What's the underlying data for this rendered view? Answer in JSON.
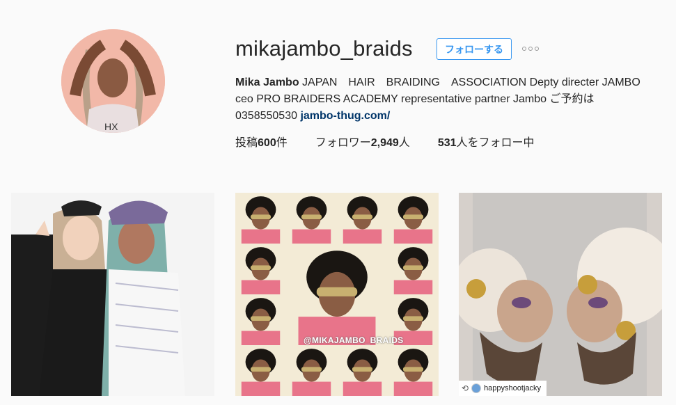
{
  "profile": {
    "username": "mikajambo_braids",
    "follow_label": "フォローする",
    "bio_name": "Mika Jambo",
    "bio_line1": " JAPAN　HAIR　BRAIDING　ASSOCIATION Depty directer JAMBO",
    "bio_line2": "ceo PRO BRAIDERS ACADEMY representative partner Jambo ご予約は",
    "bio_line3": "0358550530 ",
    "website": "jambo-thug.com/"
  },
  "stats": {
    "posts_prefix": "投稿",
    "posts_count": "600",
    "posts_suffix": "件",
    "followers_prefix": "フォロワー",
    "followers_count": "2,949",
    "followers_suffix": "人",
    "following_count": "531",
    "following_suffix": "人をフォロー中"
  },
  "posts": {
    "watermark": "@MIKAJAMBO_BRAIDS",
    "repost_user": "happyshootjacky"
  },
  "icons": {
    "more": "more-options-icon",
    "repost": "repost-icon"
  },
  "colors": {
    "accent": "#3897f0",
    "link": "#003569",
    "background": "#fafafa"
  }
}
